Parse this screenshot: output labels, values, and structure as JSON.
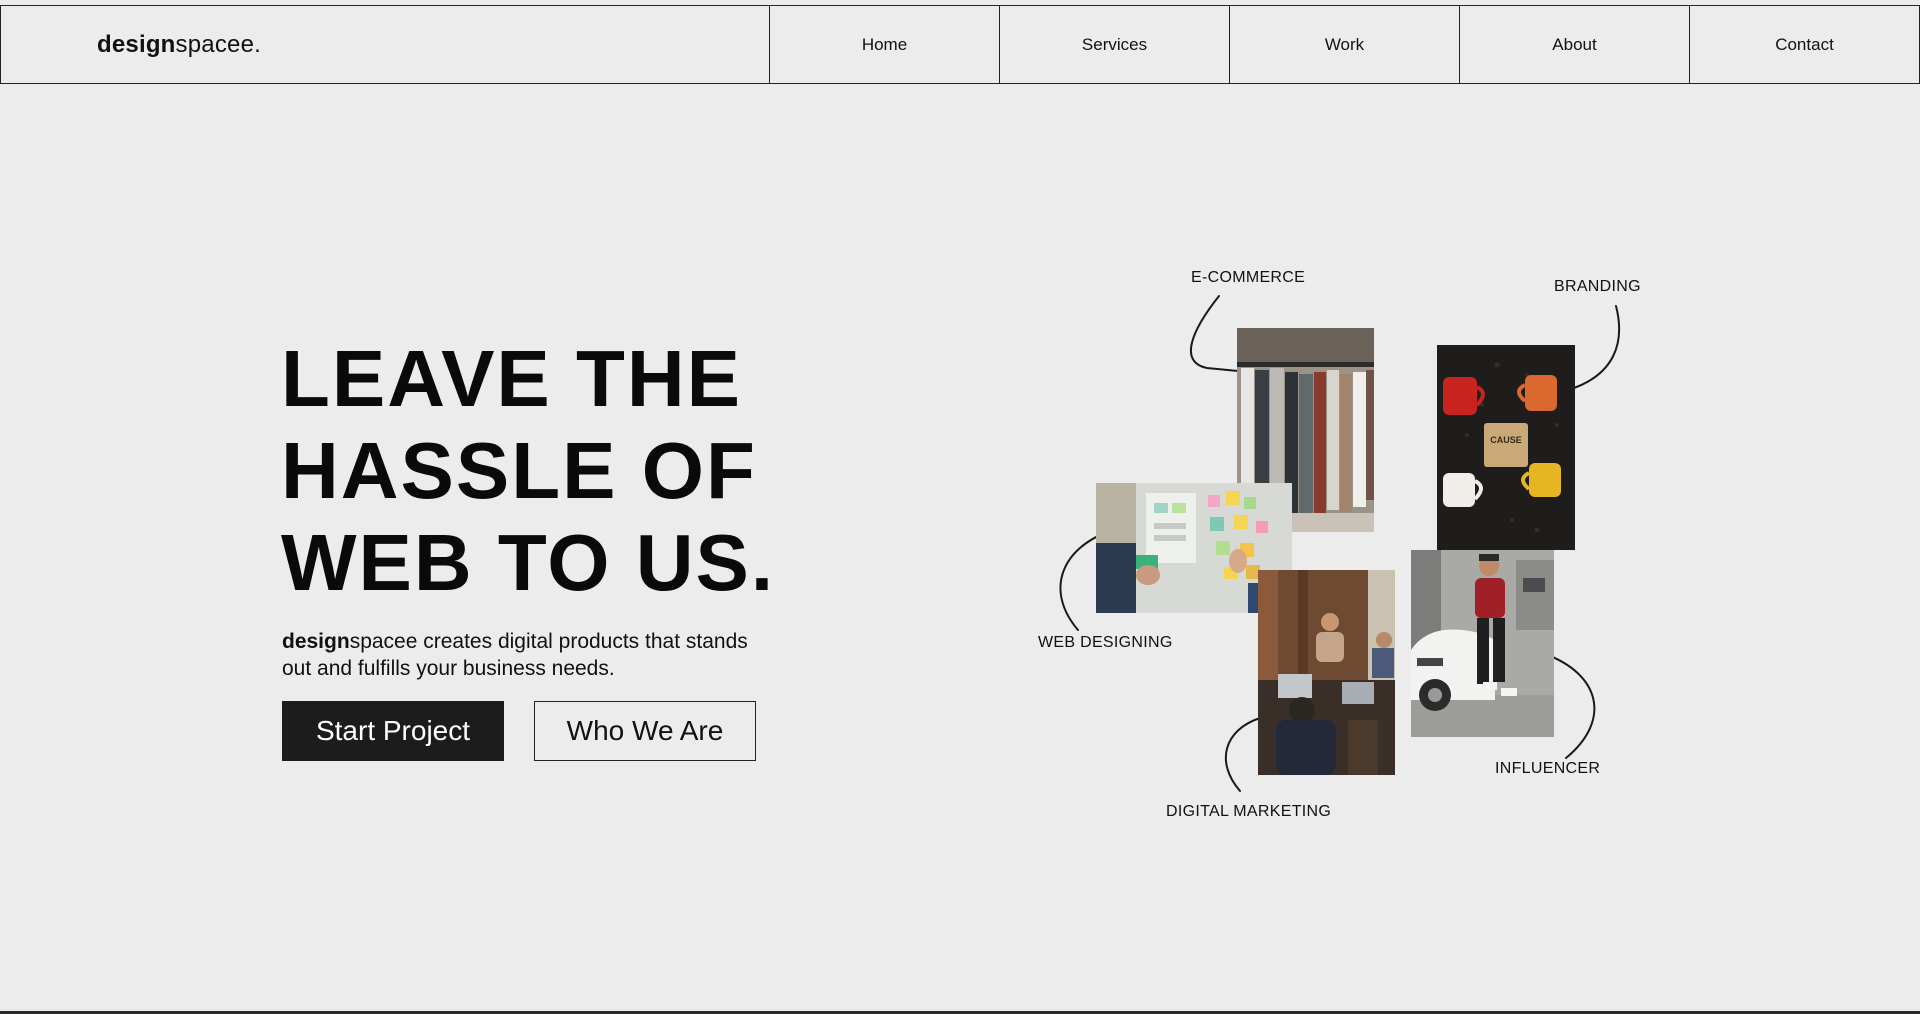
{
  "header": {
    "brand_bold": "design",
    "brand_rest": "spacee.",
    "nav": [
      "Home",
      "Services",
      "Work",
      "About",
      "Contact"
    ]
  },
  "hero": {
    "title": "LEAVE THE\nHASSLE OF\nWEB TO US.",
    "desc_bold": "design",
    "desc_rest": "spacee creates digital products that stands out and fulfills your business needs.",
    "primary_button": "Start Project",
    "secondary_button": "Who We Are"
  },
  "collage": {
    "labels": {
      "ecommerce": "E-COMMERCE",
      "branding": "BRANDING",
      "web_designing": "WEB DESIGNING",
      "digital_marketing": "DIGITAL MARKETING",
      "influencer": "INFLUENCER"
    },
    "mug_text": "CAUSE"
  },
  "colors": {
    "background": "#ececec",
    "text": "#111111",
    "primary_button": "#1c1c1c"
  }
}
